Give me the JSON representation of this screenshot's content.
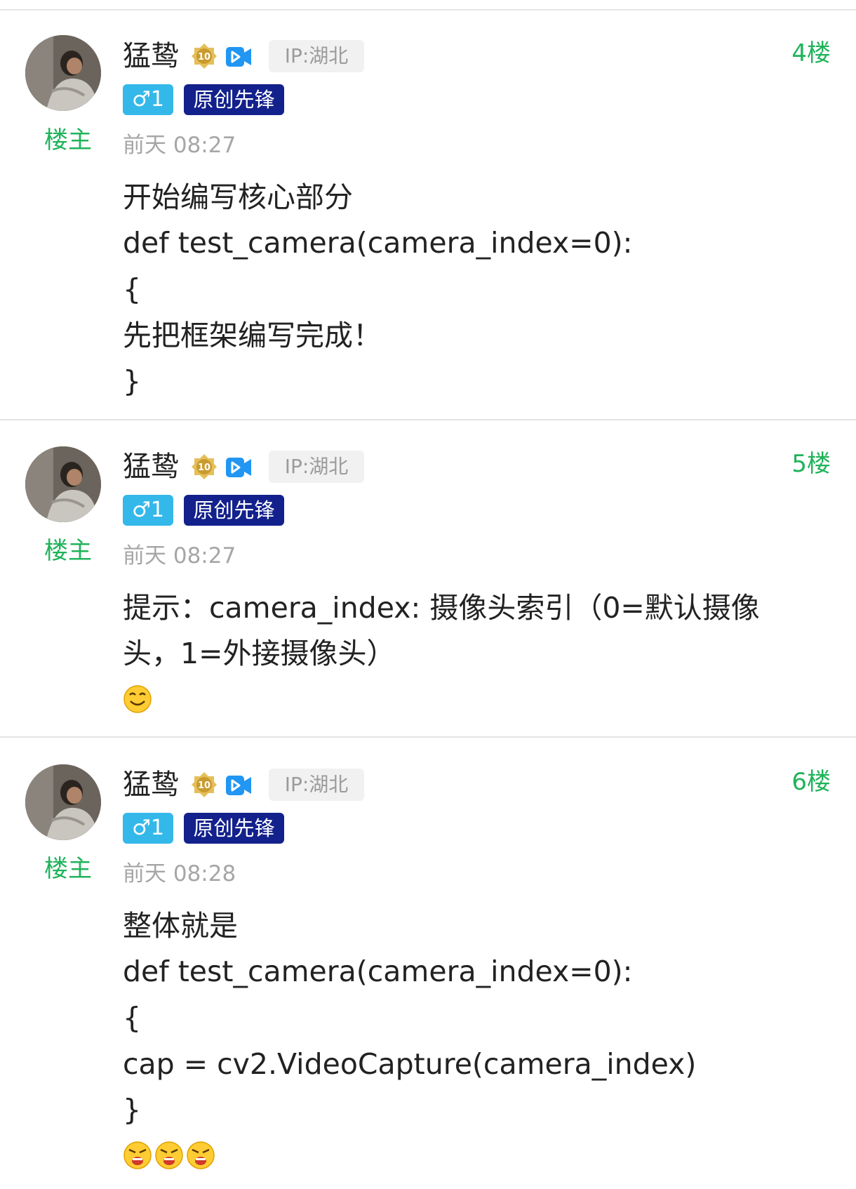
{
  "colors": {
    "accent_green": "#1fb35a",
    "gender_badge": "#34b8ea",
    "title_badge": "#13218c",
    "muted_text": "#a6a6a6"
  },
  "posts": [
    {
      "username": "猛鸷",
      "level_icon": "level-10-badge-icon",
      "ip": "IP:湖北",
      "floor": "4楼",
      "gender_badge": "♂1",
      "title_badge": "原创先锋",
      "owner_label": "楼主",
      "timestamp": "前天 08:27",
      "content_lines": [
        "开始编写核心部分",
        "def test_camera(camera_index=0):",
        "{",
        "先把框架编写完成！",
        "}"
      ],
      "emojis": []
    },
    {
      "username": "猛鸷",
      "level_icon": "level-10-badge-icon",
      "ip": "IP:湖北",
      "floor": "5楼",
      "gender_badge": "♂1",
      "title_badge": "原创先锋",
      "owner_label": "楼主",
      "timestamp": "前天 08:27",
      "content_lines": [
        "提示：camera_index: 摄像头索引（0=默认摄像",
        "头，1=外接摄像头）"
      ],
      "emojis": [
        "smile-emoji-icon"
      ]
    },
    {
      "username": "猛鸷",
      "level_icon": "level-10-badge-icon",
      "ip": "IP:湖北",
      "floor": "6楼",
      "gender_badge": "♂1",
      "title_badge": "原创先锋",
      "owner_label": "楼主",
      "timestamp": "前天 08:28",
      "content_lines": [
        "整体就是",
        "def test_camera(camera_index=0):",
        "{",
        "cap = cv2.VideoCapture(camera_index)",
        "}"
      ],
      "emojis": [
        "angry-emoji-icon",
        "angry-emoji-icon",
        "angry-emoji-icon"
      ]
    }
  ]
}
